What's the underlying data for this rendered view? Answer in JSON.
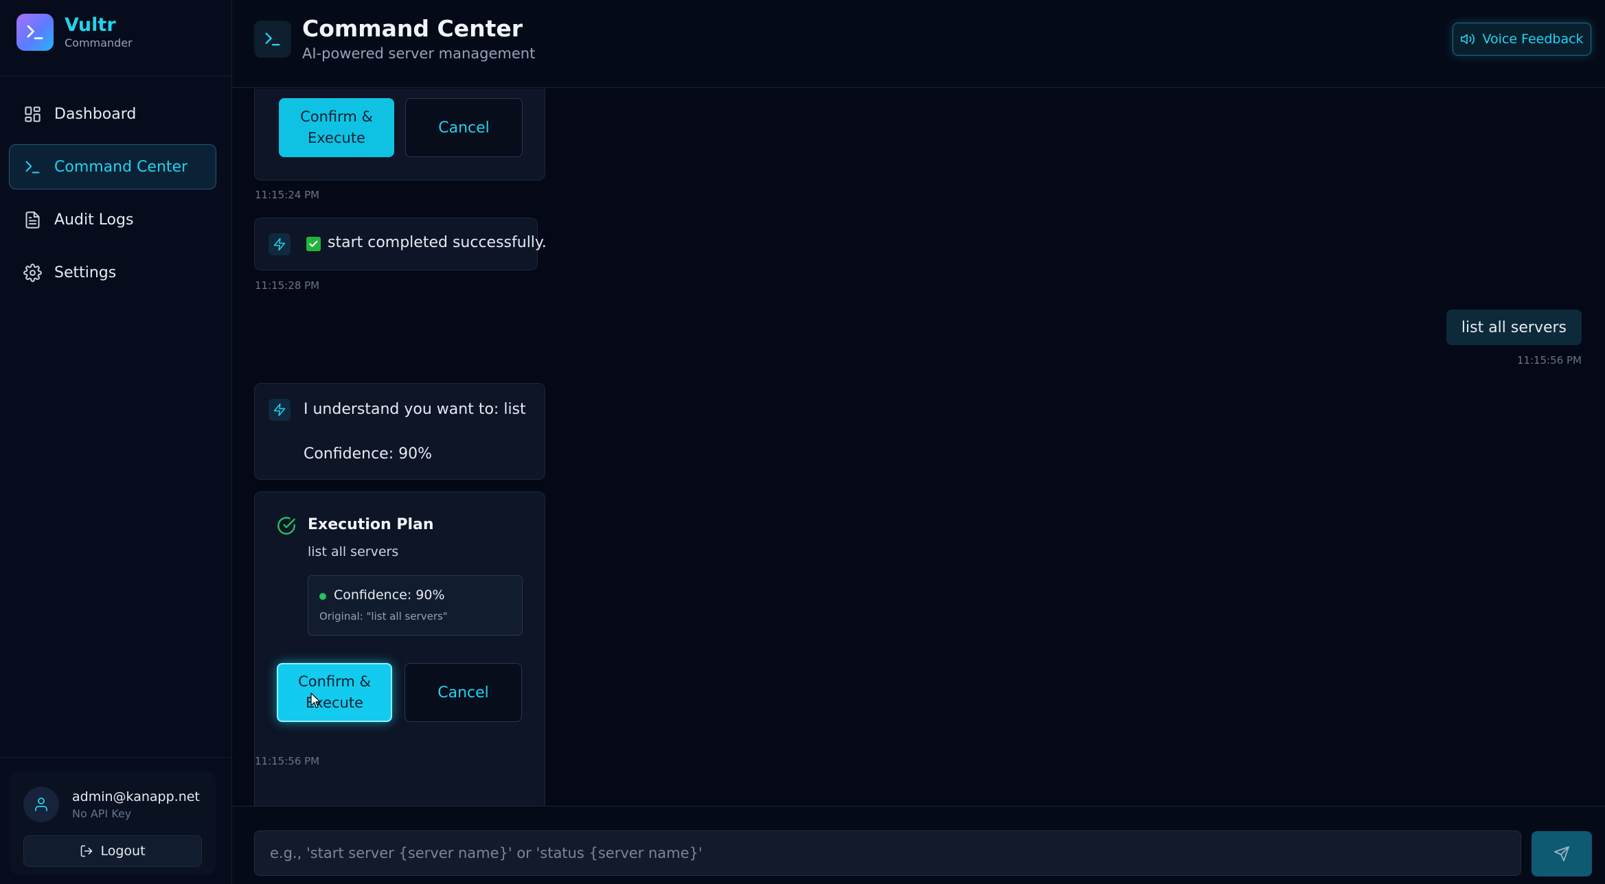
{
  "brand": {
    "title": "Vultr",
    "subtitle": "Commander"
  },
  "nav": [
    {
      "label": "Dashboard",
      "icon": "dashboard-icon",
      "active": false
    },
    {
      "label": "Command Center",
      "icon": "terminal-icon",
      "active": true
    },
    {
      "label": "Audit Logs",
      "icon": "file-text-icon",
      "active": false
    },
    {
      "label": "Settings",
      "icon": "gear-icon",
      "active": false
    }
  ],
  "user": {
    "email": "admin@kanapp.net",
    "api_key_status": "No API Key",
    "logout_label": "Logout"
  },
  "header": {
    "title": "Command Center",
    "subtitle": "AI-powered server management",
    "voice_label": "Voice Feedback"
  },
  "chat": {
    "first_plan": {
      "confirm_label": "Confirm & Execute",
      "cancel_label": "Cancel",
      "timestamp": "11:15:24 PM"
    },
    "start_result": {
      "text": "start completed successfully.",
      "timestamp": "11:15:28 PM"
    },
    "user_message": {
      "text": "list all servers",
      "timestamp": "11:15:56 PM"
    },
    "understanding": {
      "line1": "I understand you want to: list",
      "line2": "Confidence: 90%"
    },
    "plan": {
      "title": "Execution Plan",
      "description": "list all servers",
      "confidence": "Confidence: 90%",
      "original": "Original: \"list all servers\"",
      "confirm_label": "Confirm & Execute",
      "cancel_label": "Cancel",
      "timestamp": "11:15:56 PM"
    }
  },
  "composer": {
    "placeholder": "e.g., 'start server {server name}' or 'status {server name}'"
  },
  "colors": {
    "accent": "#22d3ee",
    "background": "#040817",
    "success": "#22c55e"
  }
}
